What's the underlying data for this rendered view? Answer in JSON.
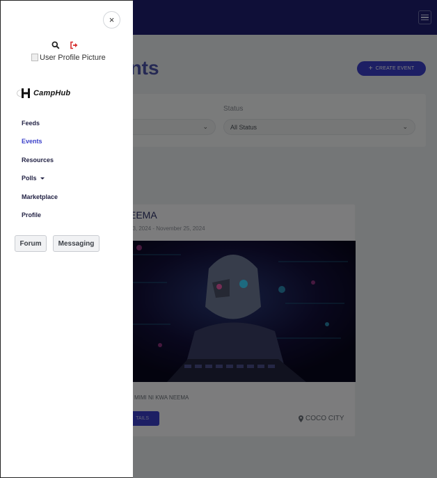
{
  "page": {
    "title": "Events",
    "title_visible_fragment": "ents",
    "create_button_label": "CREATE EVENT"
  },
  "filters": {
    "status_label": "Status",
    "status_value": "All Status"
  },
  "event_card": {
    "title_fragment": "EEMA",
    "dates_fragment": "23, 2024 - November 25, 2024",
    "description_fragment": "MIMI NI KWA NEEMA",
    "details_button_fragment": "TAILS",
    "location": "COCO CITY"
  },
  "sidebar": {
    "close_label": "×",
    "avatar_alt": "User Profile Picture",
    "brand": "CampHub",
    "nav_items": [
      {
        "label": "Feeds"
      },
      {
        "label": "Events"
      },
      {
        "label": "Resources"
      },
      {
        "label": "Polls"
      },
      {
        "label": "Marketplace"
      },
      {
        "label": "Profile"
      }
    ],
    "buttons": {
      "forum": "Forum",
      "messaging": "Messaging"
    }
  },
  "colors": {
    "navbar": "#1e1f70",
    "accent": "#3a3fc9",
    "logout_icon": "#d62d2d"
  },
  "icons": [
    "hamburger-icon",
    "close-icon",
    "search-icon",
    "logout-icon",
    "camphub-logo-icon",
    "caret-down-icon",
    "chevron-down-icon",
    "map-marker-icon",
    "plus-icon"
  ]
}
